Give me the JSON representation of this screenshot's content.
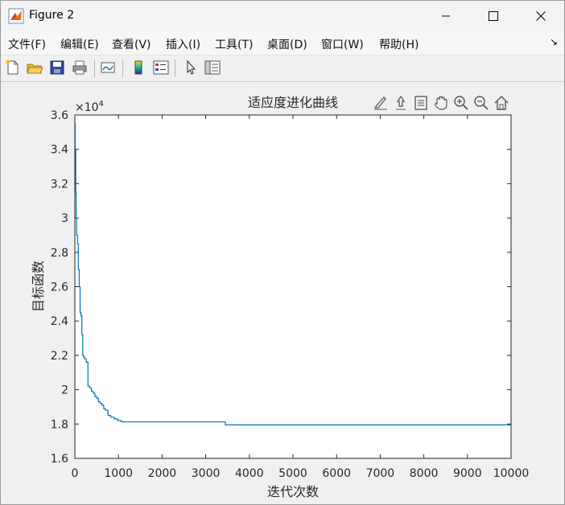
{
  "window": {
    "title": "Figure 2"
  },
  "menu": {
    "items": [
      "文件(F)",
      "编辑(E)",
      "查看(V)",
      "插入(I)",
      "工具(T)",
      "桌面(D)",
      "窗口(W)",
      "帮助(H)"
    ]
  },
  "toolbar": {
    "icons": [
      "new-figure-icon",
      "open-file-icon",
      "save-icon",
      "print-icon",
      "link-plot-icon",
      "colorbar-icon",
      "legend-icon",
      "pointer-icon",
      "property-inspector-icon"
    ]
  },
  "axes_toolbar": {
    "icons": [
      "brush-icon",
      "data-tips-icon",
      "data-cursor-icon",
      "pan-icon",
      "zoom-in-icon",
      "zoom-out-icon",
      "home-icon"
    ]
  },
  "colors": {
    "line": "#0072bd",
    "axes_bg": "#ffffff",
    "figure_bg": "#f0f0f0"
  },
  "chart_data": {
    "type": "line",
    "title": "适应度进化曲线",
    "xlabel": "迭代次数",
    "ylabel": "目标函数",
    "y_exponent_label": "×10",
    "y_exponent_power": "4",
    "xlim": [
      0,
      10000
    ],
    "ylim": [
      16000,
      36000
    ],
    "x_ticks": [
      0,
      1000,
      2000,
      3000,
      4000,
      5000,
      6000,
      7000,
      8000,
      9000,
      10000
    ],
    "x_tick_labels": [
      "0",
      "1000",
      "2000",
      "3000",
      "4000",
      "5000",
      "6000",
      "7000",
      "8000",
      "9000",
      "10000"
    ],
    "y_ticks": [
      16000,
      18000,
      20000,
      22000,
      24000,
      26000,
      28000,
      30000,
      32000,
      34000,
      36000
    ],
    "y_tick_labels": [
      "1.6",
      "1.8",
      "2",
      "2.2",
      "2.4",
      "2.6",
      "2.8",
      "3",
      "3.2",
      "3.4",
      "3.6"
    ],
    "grid": false,
    "series": [
      {
        "x": [
          1,
          10,
          20,
          30,
          40,
          60,
          80,
          100,
          120,
          140,
          160,
          180,
          200,
          220,
          260,
          300,
          340,
          380,
          420,
          460,
          500,
          540,
          580,
          620,
          660,
          700,
          760,
          820,
          900,
          980,
          1050,
          1100,
          1200,
          3400,
          3450,
          5000,
          8000,
          10000
        ],
        "y": [
          35500,
          34000,
          31500,
          30000,
          29000,
          28500,
          27000,
          26000,
          24500,
          24300,
          23200,
          22000,
          21900,
          21800,
          21600,
          20200,
          20100,
          19900,
          19800,
          19600,
          19500,
          19300,
          19200,
          19100,
          18900,
          18800,
          18500,
          18400,
          18300,
          18200,
          18150,
          18120,
          18120,
          18120,
          17950,
          17950,
          17950,
          17950
        ]
      }
    ]
  }
}
